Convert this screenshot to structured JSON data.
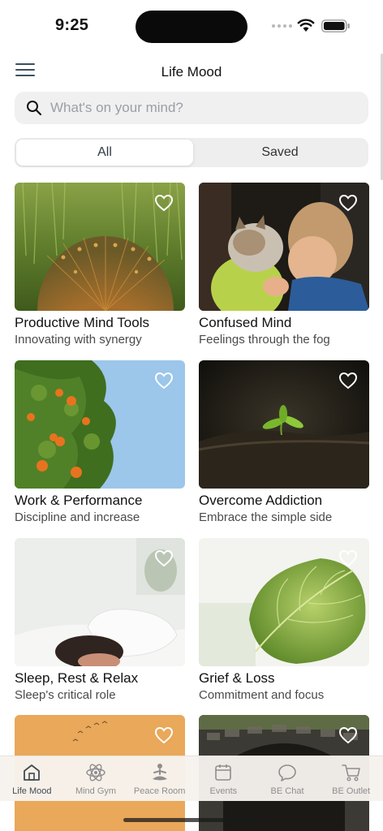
{
  "status_bar": {
    "time": "9:25"
  },
  "header": {
    "title": "Life Mood"
  },
  "search": {
    "placeholder": "What's on your mind?",
    "value": ""
  },
  "segments": [
    {
      "label": "All",
      "active": true
    },
    {
      "label": "Saved",
      "active": false
    }
  ],
  "cards": [
    {
      "title": "Productive Mind Tools",
      "subtitle": "Innovating with synergy",
      "icon": "peacock-image",
      "saved": false
    },
    {
      "title": "Confused Mind",
      "subtitle": "Feelings through the fog",
      "icon": "child-with-kitten-image",
      "saved": false
    },
    {
      "title": "Work & Performance",
      "subtitle": "Discipline and increase",
      "icon": "orange-tree-image",
      "saved": false
    },
    {
      "title": "Overcome Addiction",
      "subtitle": "Embrace the simple side",
      "icon": "sprout-image",
      "saved": false
    },
    {
      "title": "Sleep, Rest & Relax",
      "subtitle": "Sleep's critical role",
      "icon": "sleeping-person-image",
      "saved": false
    },
    {
      "title": "Grief & Loss",
      "subtitle": "Commitment and focus",
      "icon": "green-leaf-image",
      "saved": false
    },
    {
      "title": "",
      "subtitle": "",
      "icon": "birds-sunset-image",
      "saved": false
    },
    {
      "title": "",
      "subtitle": "",
      "icon": "stone-bridge-image",
      "saved": false
    }
  ],
  "tab_bar": [
    {
      "label": "Life Mood",
      "icon": "home-icon",
      "active": true
    },
    {
      "label": "Mind Gym",
      "icon": "atom-icon",
      "active": false
    },
    {
      "label": "Peace Room",
      "icon": "meditation-icon",
      "active": false
    },
    {
      "label": "Events",
      "icon": "calendar-icon",
      "active": false
    },
    {
      "label": "BE Chat",
      "icon": "chat-bubble-icon",
      "active": false
    },
    {
      "label": "BE Outlet",
      "icon": "cart-icon",
      "active": false
    }
  ],
  "colors": {
    "accent": "#3f4b55",
    "inactive_tab": "#8e8e8e",
    "tab_bar_bg": "#f6f3ee",
    "search_bg": "#f0f0f1"
  }
}
